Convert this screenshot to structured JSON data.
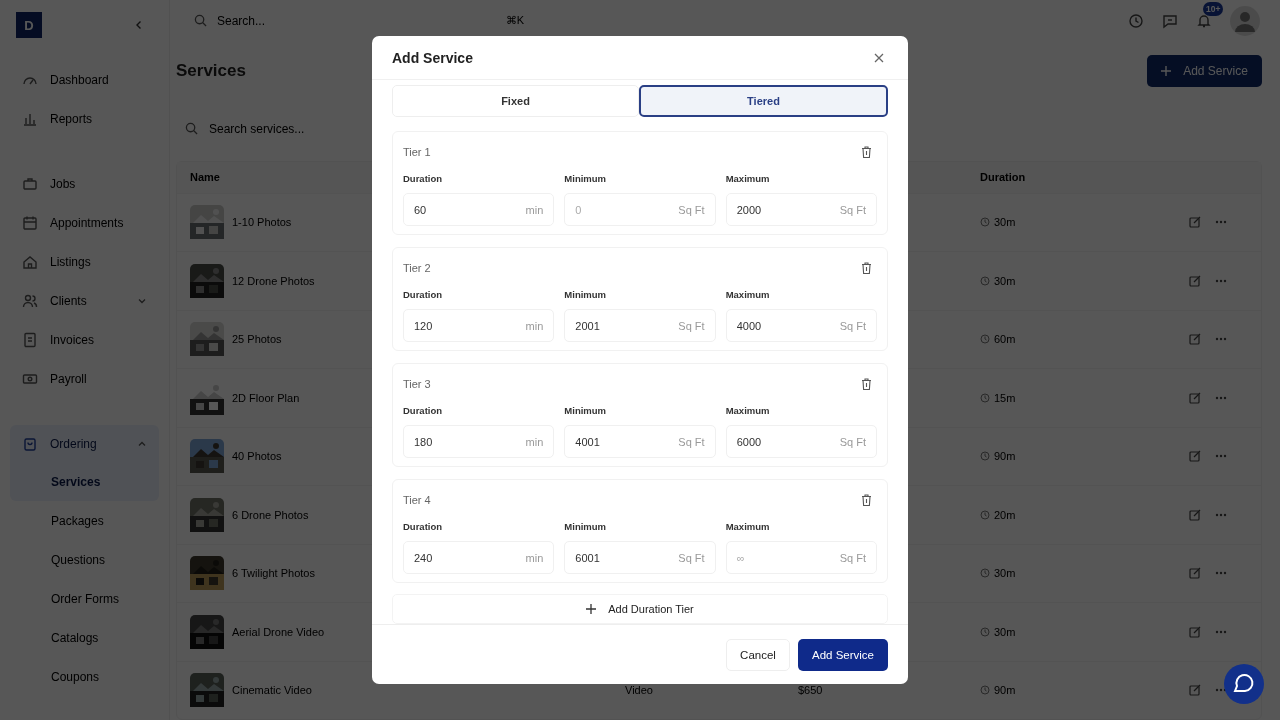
{
  "app": {
    "logo": "D"
  },
  "topbar": {
    "search_placeholder": "Search...",
    "shortcut": "⌘K",
    "notification_count": "10+"
  },
  "sidebar": {
    "items": [
      {
        "label": "Dashboard",
        "selected": false
      },
      {
        "label": "Reports",
        "selected": false
      },
      {
        "label": "Jobs",
        "selected": false
      },
      {
        "label": "Appointments",
        "selected": false
      },
      {
        "label": "Listings",
        "selected": false
      },
      {
        "label": "Clients",
        "selected": false,
        "expanded": false
      },
      {
        "label": "Invoices",
        "selected": false
      },
      {
        "label": "Payroll",
        "selected": false
      },
      {
        "label": "Ordering",
        "selected": true,
        "expanded": true,
        "children": [
          {
            "label": "Services",
            "selected": true
          },
          {
            "label": "Packages",
            "selected": false
          },
          {
            "label": "Questions",
            "selected": false
          },
          {
            "label": "Order Forms",
            "selected": false
          },
          {
            "label": "Catalogs",
            "selected": false
          },
          {
            "label": "Coupons",
            "selected": false
          }
        ]
      }
    ]
  },
  "page": {
    "title": "Services",
    "add_button": "Add Service",
    "search_placeholder": "Search services..."
  },
  "table": {
    "columns": [
      {
        "label": "Name"
      },
      {
        "label": "Duration"
      }
    ],
    "rows": [
      {
        "name": "1-10 Photos",
        "duration": "30m"
      },
      {
        "name": "12 Drone Photos",
        "duration": "30m"
      },
      {
        "name": "25 Photos",
        "duration": "60m"
      },
      {
        "name": "2D Floor Plan",
        "duration": "15m"
      },
      {
        "name": "40 Photos",
        "duration": "90m"
      },
      {
        "name": "6 Drone Photos",
        "duration": "20m"
      },
      {
        "name": "6 Twilight Photos",
        "duration": "30m"
      },
      {
        "name": "Aerial Drone Video",
        "duration": "30m"
      },
      {
        "name": "Cinematic Video",
        "column_2": "Video",
        "column_3": "$650",
        "duration": "90m"
      }
    ]
  },
  "modal": {
    "title": "Add Service",
    "tabs": [
      {
        "label": "Fixed",
        "selected": false
      },
      {
        "label": "Tiered",
        "selected": true
      }
    ],
    "tiers": [
      {
        "title": "Tier 1",
        "fields": [
          {
            "label": "Duration",
            "value": "60",
            "unit": "min"
          },
          {
            "label": "Minimum",
            "placeholder": "0",
            "unit": "Sq Ft"
          },
          {
            "label": "Maximum",
            "value": "2000",
            "unit": "Sq Ft"
          }
        ]
      },
      {
        "title": "Tier 2",
        "fields": [
          {
            "label": "Duration",
            "value": "120",
            "unit": "min"
          },
          {
            "label": "Minimum",
            "value": "2001",
            "unit": "Sq Ft"
          },
          {
            "label": "Maximum",
            "value": "4000",
            "unit": "Sq Ft"
          }
        ]
      },
      {
        "title": "Tier 3",
        "fields": [
          {
            "label": "Duration",
            "value": "180",
            "unit": "min"
          },
          {
            "label": "Minimum",
            "value": "4001",
            "unit": "Sq Ft"
          },
          {
            "label": "Maximum",
            "value": "6000",
            "unit": "Sq Ft"
          }
        ]
      },
      {
        "title": "Tier 4",
        "fields": [
          {
            "label": "Duration",
            "value": "240",
            "unit": "min"
          },
          {
            "label": "Minimum",
            "value": "6001",
            "unit": "Sq Ft"
          },
          {
            "label": "Maximum",
            "placeholder": "∞",
            "unit": "Sq Ft"
          }
        ]
      }
    ],
    "add_tier": "Add Duration Tier",
    "buttons": [
      {
        "label": "Cancel",
        "kind": "secondary"
      },
      {
        "label": "Add Service",
        "kind": "primary"
      }
    ]
  }
}
